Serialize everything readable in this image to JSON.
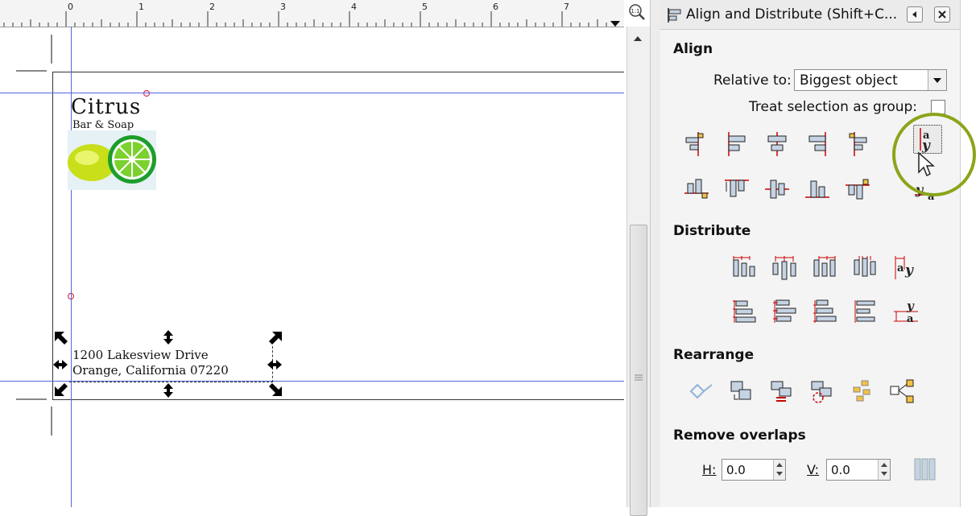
{
  "ruler": {
    "numbers": [
      "0",
      "1",
      "2",
      "3",
      "4",
      "5",
      "6",
      "7"
    ]
  },
  "document": {
    "logo": {
      "title": "Citrus",
      "tagline": "Bar & Soap"
    },
    "address": {
      "line1": "1200 Lakesview Drive",
      "line2": "Orange, California 07220"
    }
  },
  "panel": {
    "title": "Align and Distribute (Shift+C...",
    "align": {
      "heading": "Align",
      "relative_label": "Relative to:",
      "relative_value": "Biggest object",
      "treat_group_label": "Treat selection as group:"
    },
    "distribute": {
      "heading": "Distribute"
    },
    "rearrange": {
      "heading": "Rearrange"
    },
    "remove_overlaps": {
      "heading": "Remove overlaps",
      "h_label": "H:",
      "h_value": "0.0",
      "v_label": "V:",
      "v_value": "0.0"
    }
  },
  "colors": {
    "guide": "#5566dd",
    "highlight": "#8aa51a",
    "handle_red": "#cc0000",
    "icon_fill": "#c5d3e3"
  }
}
